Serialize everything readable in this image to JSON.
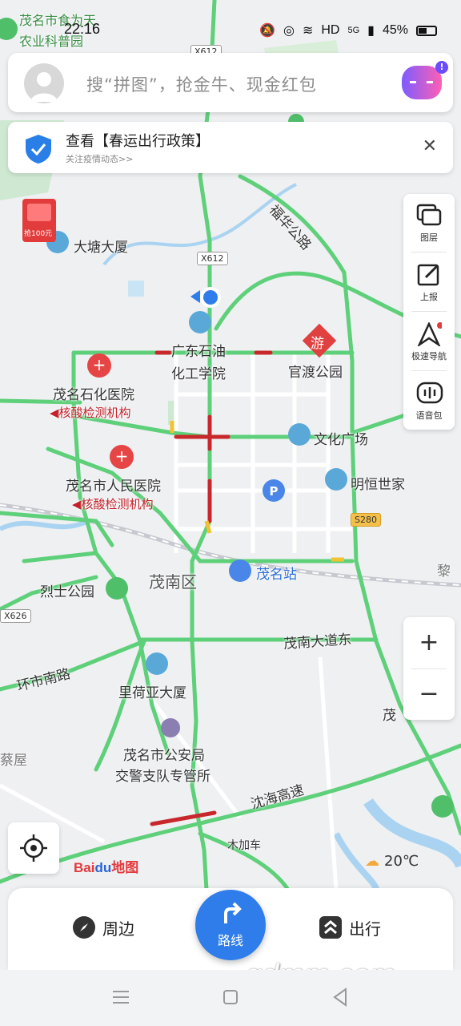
{
  "status": {
    "time": "22:16",
    "network": "HD",
    "signal": "5G",
    "battery": "45%"
  },
  "search": {
    "placeholder": "搜“拼图”，抢金牛、现金红包",
    "badge": "!"
  },
  "notice": {
    "title": "查看【春运出行政策】",
    "subtitle": "关注疫情动态>>"
  },
  "tools": [
    {
      "label": "图层",
      "icon": "layers-icon"
    },
    {
      "label": "上报",
      "icon": "report-icon"
    },
    {
      "label": "极速导航",
      "icon": "navigation-icon"
    },
    {
      "label": "语音包",
      "icon": "voice-pack-icon"
    }
  ],
  "zoom": {
    "in": "+",
    "out": "−"
  },
  "map": {
    "labels": {
      "top_left_1": "茂名市食为天",
      "top_left_2": "农业科普园",
      "datang": "大塘大厦",
      "promo": "抢100元",
      "gdsy1": "广东石油",
      "gdsy2": "化工学院",
      "guandu": "官渡公园",
      "mmsh": "茂名石化医院",
      "hs1": "核酸检测机构",
      "wenhua": "文化广场",
      "renmin": "茂名市人民医院",
      "hs2": "核酸检测机构",
      "minghe": "明恒世家",
      "maonan": "茂南区",
      "station": "茂名站",
      "lieshi": "烈士公园",
      "dadao": "茂南大道东",
      "huanshi": "环市南路",
      "lihe": "里荷亚大厦",
      "gaj1": "茂名市公安局",
      "gaj2": "交警支队专管所",
      "shenhai": "沈海高速",
      "mujia": "木加车",
      "cai": "蔡屋",
      "li": "黎",
      "mao_e": "茂",
      "luo": "福华公路",
      "you": "游"
    },
    "shields": {
      "x612a": "X612",
      "x612b": "X612",
      "s280": "S280",
      "x626": "X626"
    }
  },
  "logo": {
    "bai": "Bai",
    "du": "du",
    "map": "地图"
  },
  "weather": {
    "temp": "20℃"
  },
  "bottom": {
    "nearby": "周边",
    "route": "路线",
    "travel": "出行"
  },
  "watermark": "gdmm.com",
  "colors": {
    "road": "#5fd07a",
    "congestion": "#c8282b",
    "accent": "#2f7dea"
  }
}
